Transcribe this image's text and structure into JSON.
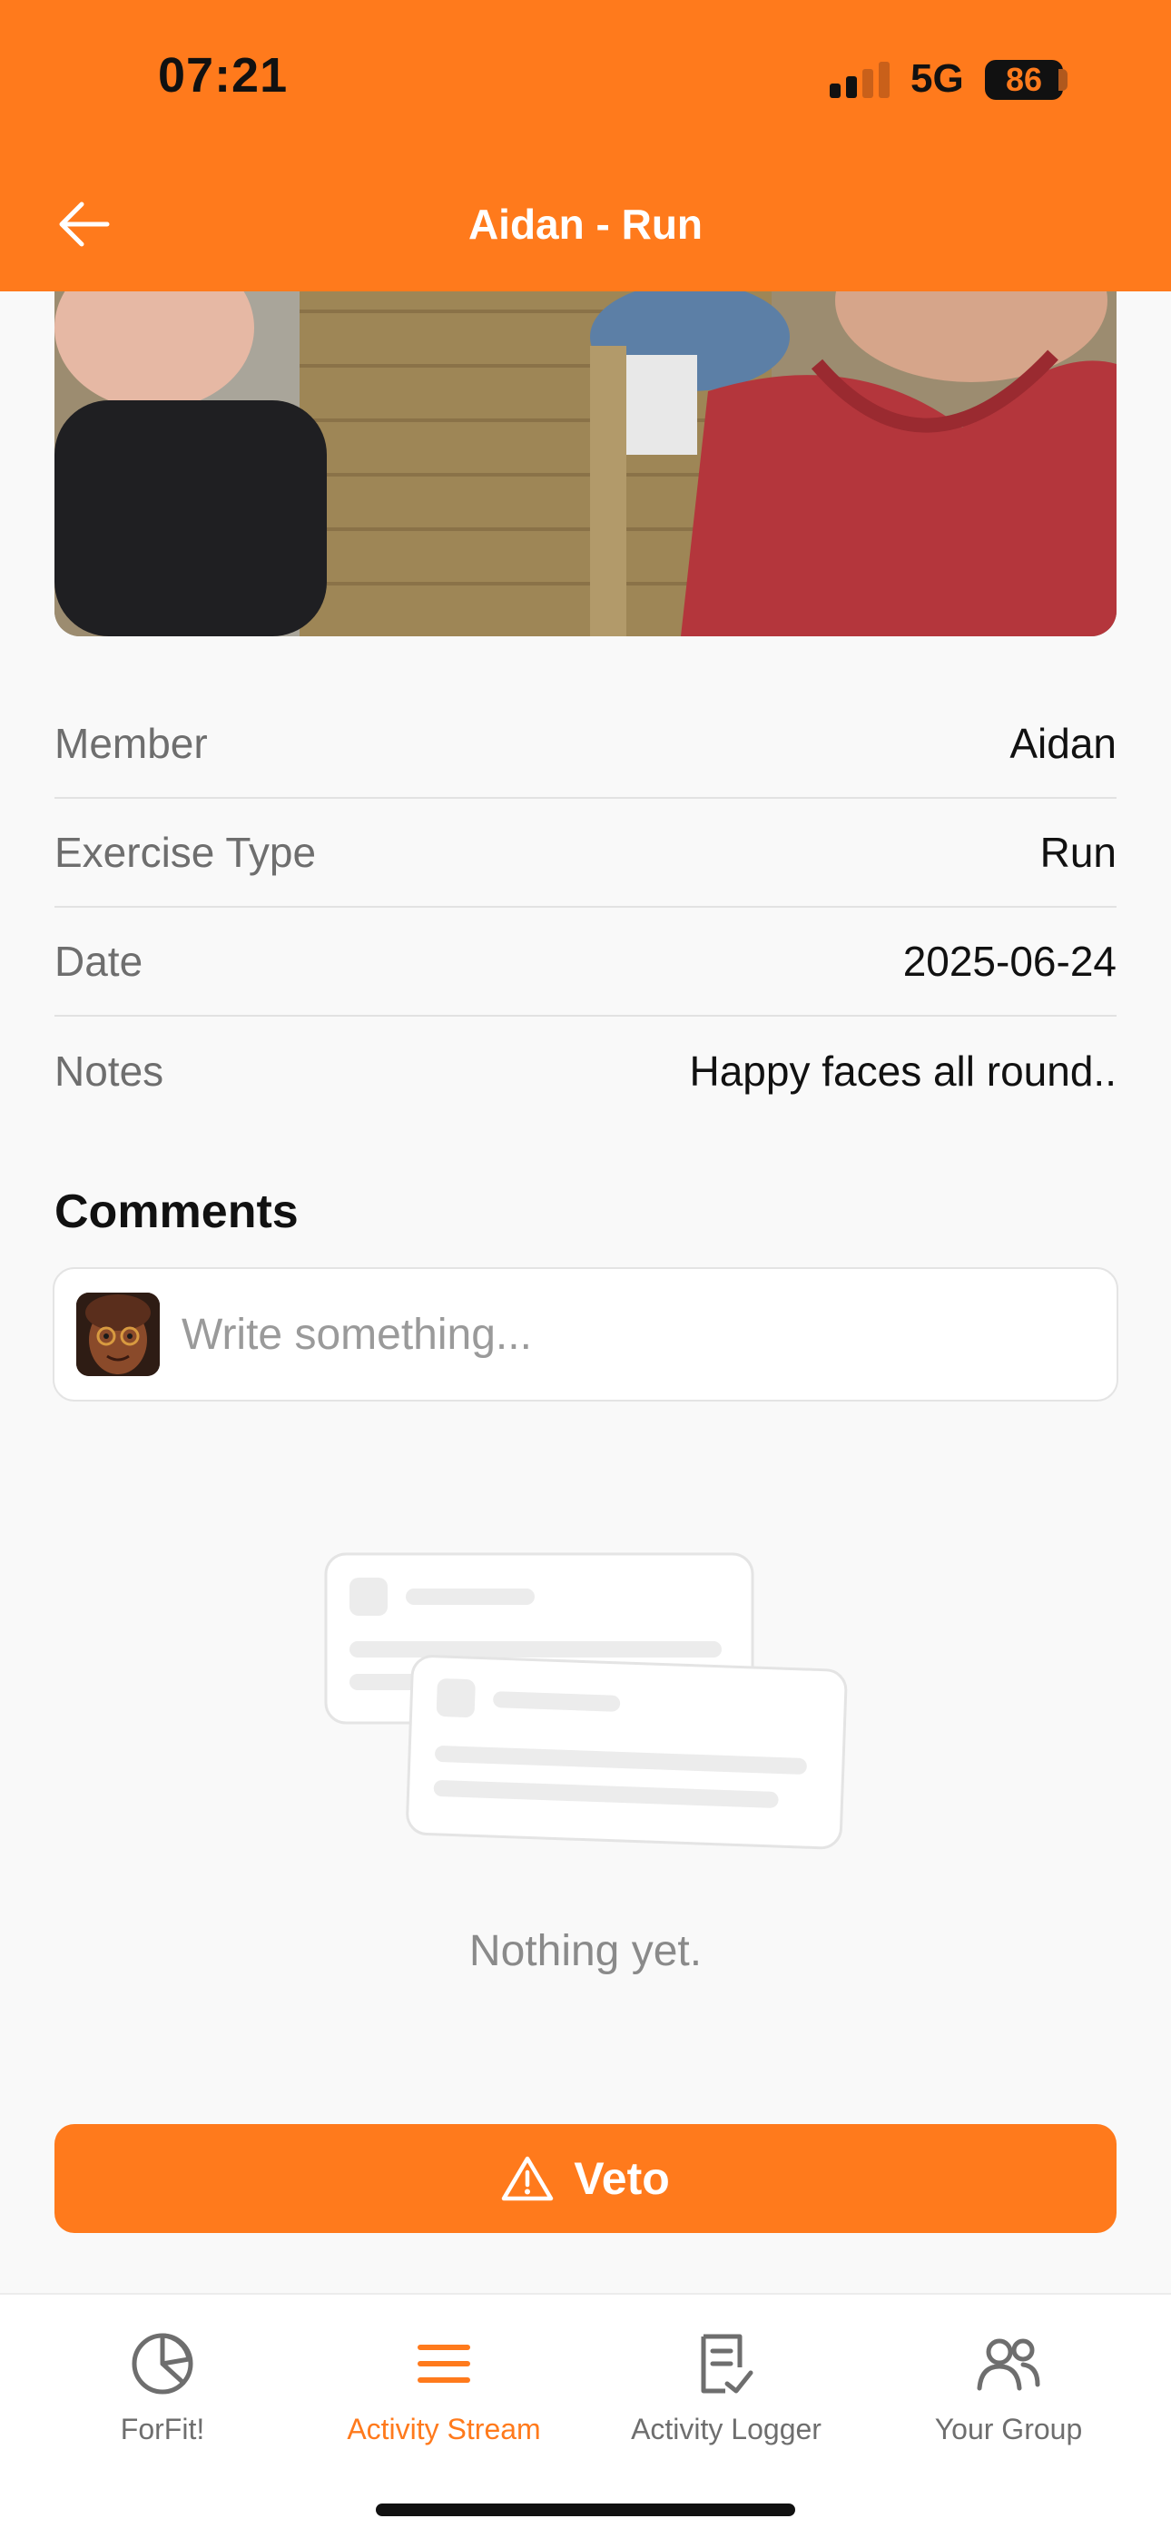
{
  "status_bar": {
    "time": "07:21",
    "network": "5G",
    "battery": "86"
  },
  "header": {
    "title": "Aidan - Run",
    "back_icon": "arrow-left-icon"
  },
  "details": [
    {
      "label": "Member",
      "value": "Aidan"
    },
    {
      "label": "Exercise Type",
      "value": "Run"
    },
    {
      "label": "Date",
      "value": "2025-06-24"
    },
    {
      "label": "Notes",
      "value": "Happy faces all round.."
    }
  ],
  "comments": {
    "title": "Comments",
    "placeholder": "Write something...",
    "empty_text": "Nothing yet."
  },
  "veto_button": {
    "label": "Veto",
    "icon": "warning-triangle-icon"
  },
  "tabs": [
    {
      "label": "ForFit!",
      "icon": "pie-chart-icon",
      "active": false
    },
    {
      "label": "Activity Stream",
      "icon": "menu-lines-icon",
      "active": true
    },
    {
      "label": "Activity Logger",
      "icon": "checklist-icon",
      "active": false
    },
    {
      "label": "Your Group",
      "icon": "group-icon",
      "active": false
    }
  ],
  "colors": {
    "accent": "#ff7a1c",
    "background": "#f9f9f9",
    "muted_text": "#6e6e6e"
  }
}
